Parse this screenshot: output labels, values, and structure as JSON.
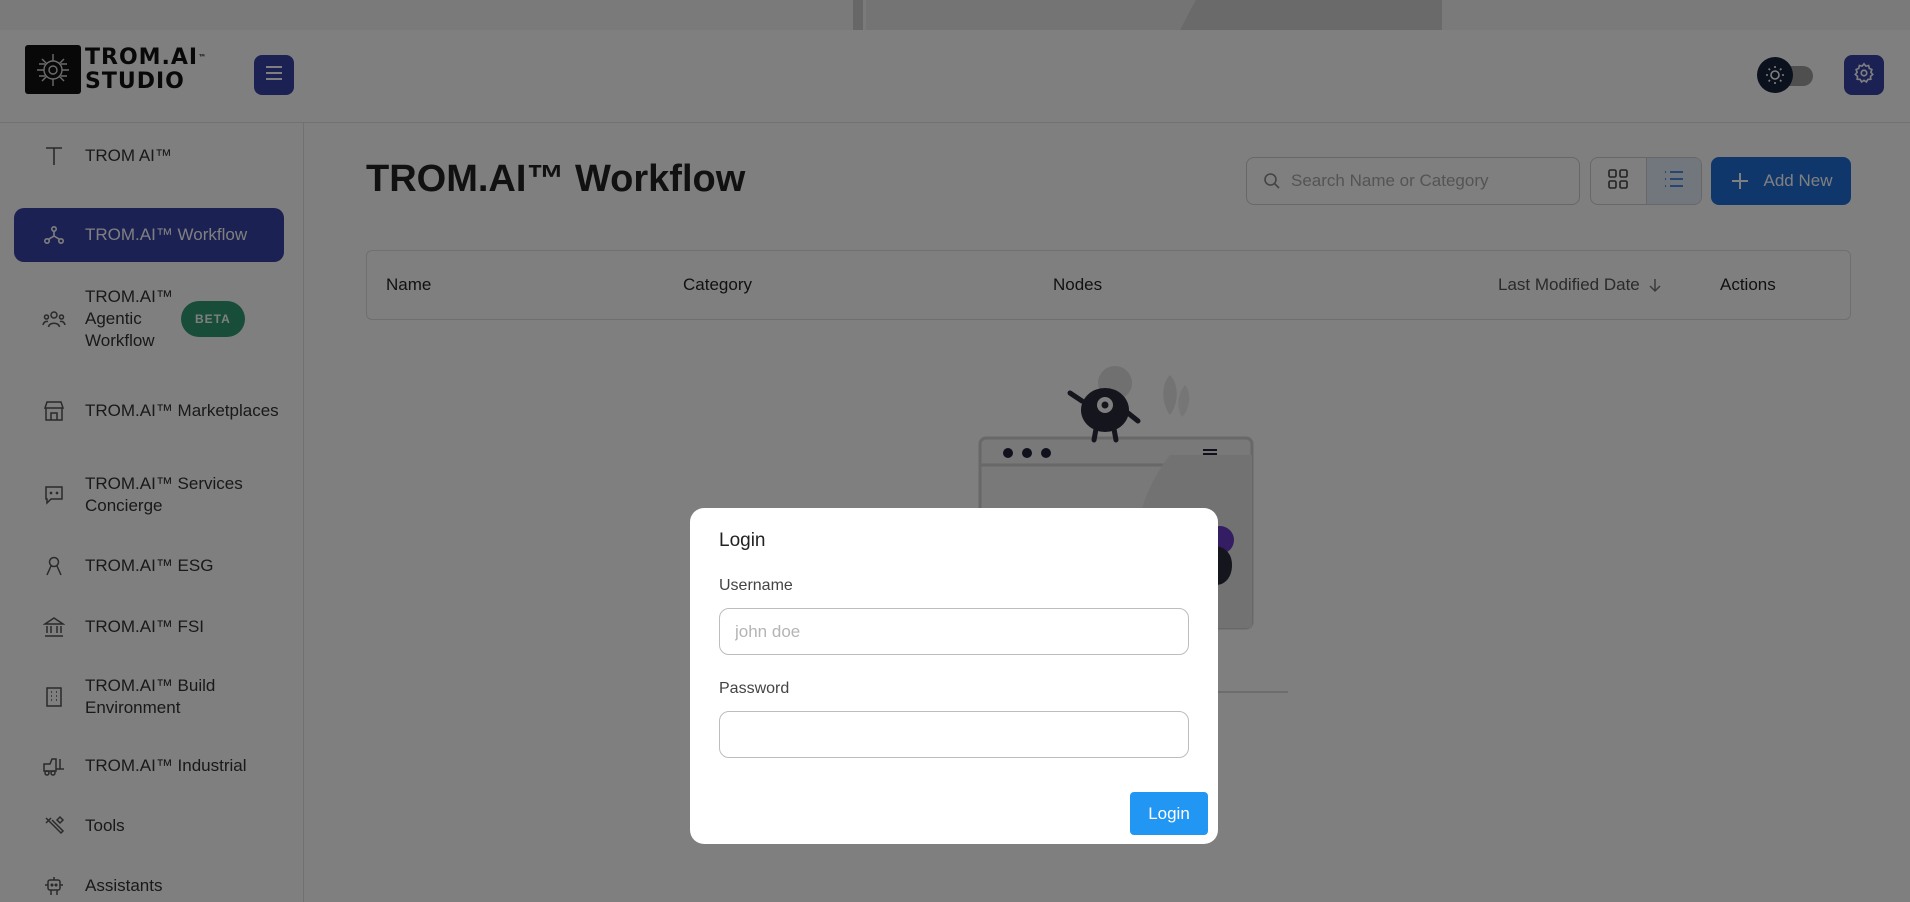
{
  "app": {
    "logo_line1": "TROM.AI",
    "logo_tm": "™",
    "logo_line2": "STUDIO"
  },
  "header": {
    "menu_icon": "hamburger-icon",
    "theme_icon": "sun-icon",
    "settings_icon": "gear-icon"
  },
  "sidebar": {
    "items": [
      {
        "label": "TROM AI™",
        "icon": "text-t-icon"
      },
      {
        "label": "TROM.AI™ Workflow",
        "icon": "workflow-icon",
        "active": true
      },
      {
        "label": "TROM.AI™ Agentic Workflow",
        "icon": "users-group-icon",
        "badge": "BETA"
      },
      {
        "label": "TROM.AI™ Marketplaces",
        "icon": "storefront-icon"
      },
      {
        "label": "TROM.AI™ Services Concierge",
        "icon": "chat-icon"
      },
      {
        "label": "TROM.AI™ ESG",
        "icon": "ribbon-icon"
      },
      {
        "label": "TROM.AI™ FSI",
        "icon": "bank-icon"
      },
      {
        "label": "TROM.AI™ Build Environment",
        "icon": "building-icon"
      },
      {
        "label": "TROM.AI™ Industrial",
        "icon": "forklift-icon"
      },
      {
        "label": "Tools",
        "icon": "tools-icon"
      },
      {
        "label": "Assistants",
        "icon": "robot-icon"
      }
    ]
  },
  "main": {
    "title": "TROM.AI™ Workflow",
    "search_placeholder": "Search Name or Category",
    "add_label": "Add New",
    "table_headers": {
      "name": "Name",
      "category": "Category",
      "nodes": "Nodes",
      "last_modified": "Last Modified Date",
      "actions": "Actions"
    }
  },
  "modal": {
    "title": "Login",
    "username_label": "Username",
    "username_placeholder": "john doe",
    "username_value": "",
    "password_label": "Password",
    "password_value": "",
    "submit_label": "Login"
  },
  "colors": {
    "primary": "#3843a8",
    "accent_blue": "#1e6fd9",
    "login_blue": "#2196f3",
    "beta_green": "#2e9a73"
  }
}
